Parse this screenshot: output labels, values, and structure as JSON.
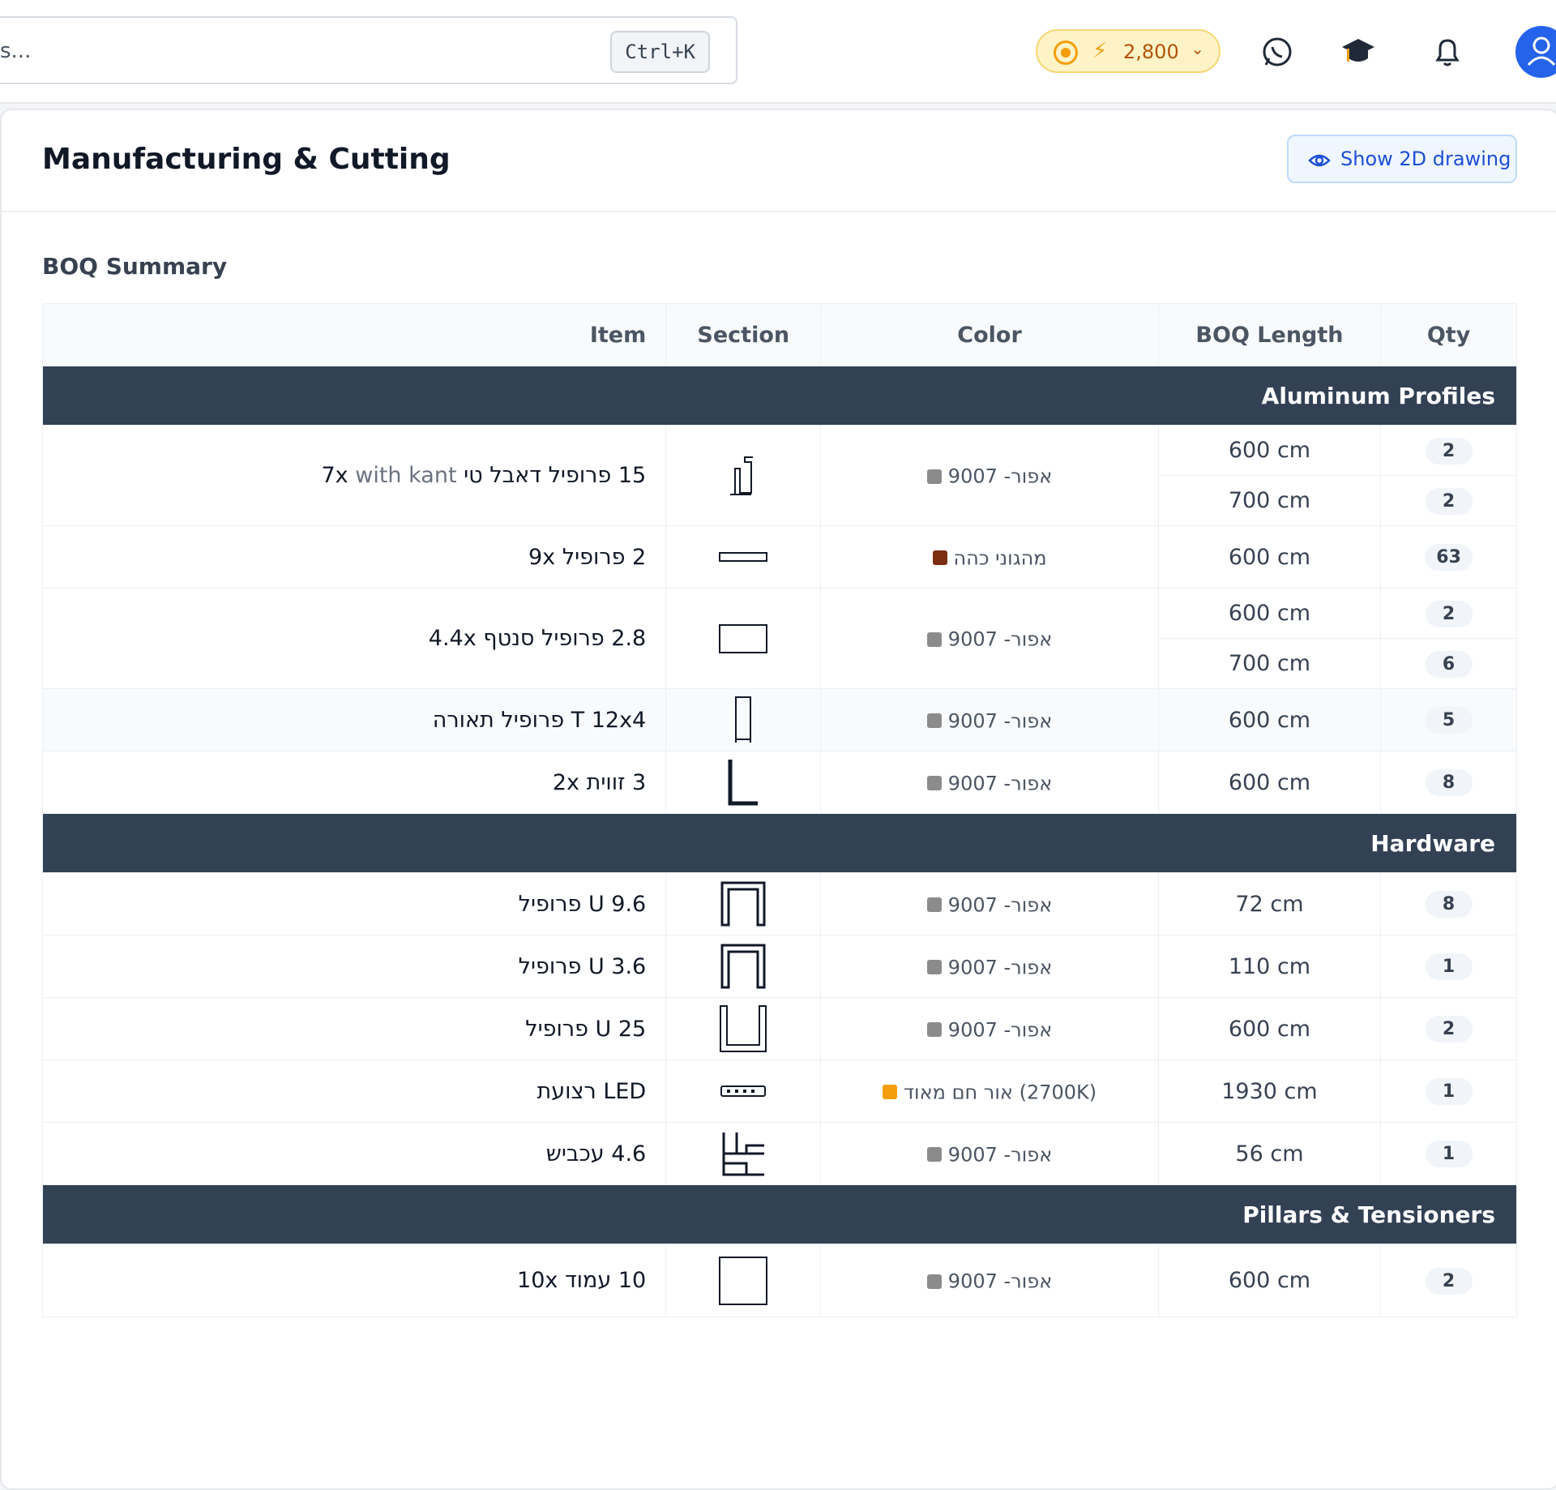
{
  "header": {
    "search_placeholder": "s...",
    "shortcut": "Ctrl+K",
    "credits": "2,800",
    "icons": [
      "whatsapp-icon",
      "graduation-cap-icon",
      "bell-icon",
      "user-icon"
    ]
  },
  "page": {
    "title": "Manufacturing & Cutting",
    "show_drawing_label": "Show 2D drawing",
    "subtitle": "BOQ Summary"
  },
  "table": {
    "headers": {
      "item": "Item",
      "section": "Section",
      "color": "Color",
      "length": "BOQ Length",
      "qty": "Qty"
    },
    "groups": [
      {
        "name": "Aluminum Profiles"
      },
      {
        "name": "Hardware"
      },
      {
        "name": "Pillars & Tensioners"
      }
    ],
    "rows": [
      {
        "item": "15 פרופיל דאבל טי 7x",
        "note": "with kant",
        "color": "9007 -אפור",
        "lengths": [
          "600 cm",
          "700 cm"
        ],
        "qtys": [
          "2",
          "2"
        ]
      },
      {
        "item": "2 פרופיל 9x",
        "color": "מהגוני כהה",
        "lengths": [
          "600 cm"
        ],
        "qtys": [
          "63"
        ]
      },
      {
        "item": "2.8 פרופיל סנטף 4.4x",
        "color": "9007 -אפור",
        "lengths": [
          "600 cm",
          "700 cm"
        ],
        "qtys": [
          "2",
          "6"
        ]
      },
      {
        "item": "T 12x4 פרופיל תאורה",
        "color": "9007 -אפור",
        "lengths": [
          "600 cm"
        ],
        "qtys": [
          "5"
        ]
      },
      {
        "item": "3 זווית 2x",
        "color": "9007 -אפור",
        "lengths": [
          "600 cm"
        ],
        "qtys": [
          "8"
        ]
      },
      {
        "item": "U 9.6 פרופיל",
        "color": "9007 -אפור",
        "lengths": [
          "72 cm"
        ],
        "qtys": [
          "8"
        ]
      },
      {
        "item": "U 3.6 פרופיל",
        "color": "9007 -אפור",
        "lengths": [
          "110 cm"
        ],
        "qtys": [
          "1"
        ]
      },
      {
        "item": "U 25 פרופיל",
        "color": "9007 -אפור",
        "lengths": [
          "600 cm"
        ],
        "qtys": [
          "2"
        ]
      },
      {
        "item": "LED רצועת",
        "color": "אור חם מאוד (2700K)",
        "lengths": [
          "1930 cm"
        ],
        "qtys": [
          "1"
        ]
      },
      {
        "item": "4.6 עכביש",
        "color": "9007 -אפור",
        "lengths": [
          "56 cm"
        ],
        "qtys": [
          "1"
        ]
      },
      {
        "item": "10 עמוד 10x",
        "color": "9007 -אפור",
        "lengths": [
          "600 cm"
        ],
        "qtys": [
          "2"
        ]
      }
    ]
  },
  "colors": {
    "grey_swatch": "#8b8b8b",
    "mahogany_swatch": "#7c2d12",
    "led_swatch": "#f59e0b",
    "group_header": "#334155",
    "accent": "#1d4ed8"
  }
}
